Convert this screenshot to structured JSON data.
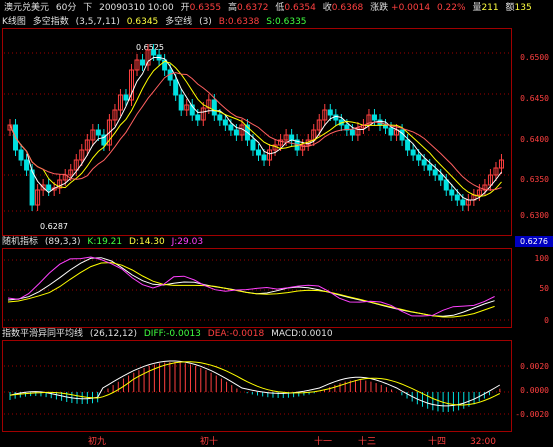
{
  "header": {
    "symbol": "澳元兑美元",
    "period": "60分",
    "mode": "下",
    "datetime": "20090310 10:00",
    "open_label": "开",
    "open": "0.6355",
    "high_label": "高",
    "high": "0.6372",
    "low_label": "低",
    "low": "0.6354",
    "close_label": "收",
    "close": "0.6368",
    "change_label": "涨跌",
    "change": "+0.0014",
    "change_pct": "0.22%",
    "volume_label": "量",
    "volume": "211",
    "amount_label": "额",
    "amount": "135"
  },
  "main_panel": {
    "chart_label": "K线图",
    "indicator_name": "多空指数",
    "params": "(3,5,7,11)",
    "value": "0.6345",
    "line2_name": "多空线",
    "line2_params": "(3)",
    "b_label": "B:",
    "b_value": "0.6338",
    "s_label": "S:",
    "s_value": "0.6335",
    "y_ticks": [
      "0.6500",
      "0.6450",
      "0.6400",
      "0.6350",
      "0.6300"
    ],
    "high_marker": "0.6525",
    "low_marker": "0.6287",
    "current_price": "0.6276"
  },
  "kdj_panel": {
    "name": "随机指标",
    "params": "(89,3,3)",
    "k_label": "K:",
    "k_value": "19.21",
    "d_label": "D:",
    "d_value": "14.30",
    "j_label": "J:",
    "j_value": "29.03",
    "y_ticks": [
      "100",
      "50",
      "0"
    ]
  },
  "macd_panel": {
    "name": "指数平滑异同平均线",
    "params": "(26,12,12)",
    "diff_label": "DIFF:",
    "diff_value": "-0.0013",
    "dea_label": "DEA:",
    "dea_value": "-0.0018",
    "macd_label": "MACD:",
    "macd_value": "0.0010",
    "y_ticks": [
      "0.0020",
      "0.0000",
      "-0.0020"
    ]
  },
  "x_axis": [
    "初九",
    "初十",
    "十一",
    "十三",
    "十四",
    "32:00"
  ],
  "colors": {
    "up": "#ff4040",
    "down": "#00e0e0",
    "grid": "#a00000",
    "ma1": "#ffffff",
    "ma2": "#ffff00",
    "ma3": "#ff6060",
    "kline": "#ffffff",
    "dline": "#ffff00",
    "jline": "#ff40ff"
  }
}
